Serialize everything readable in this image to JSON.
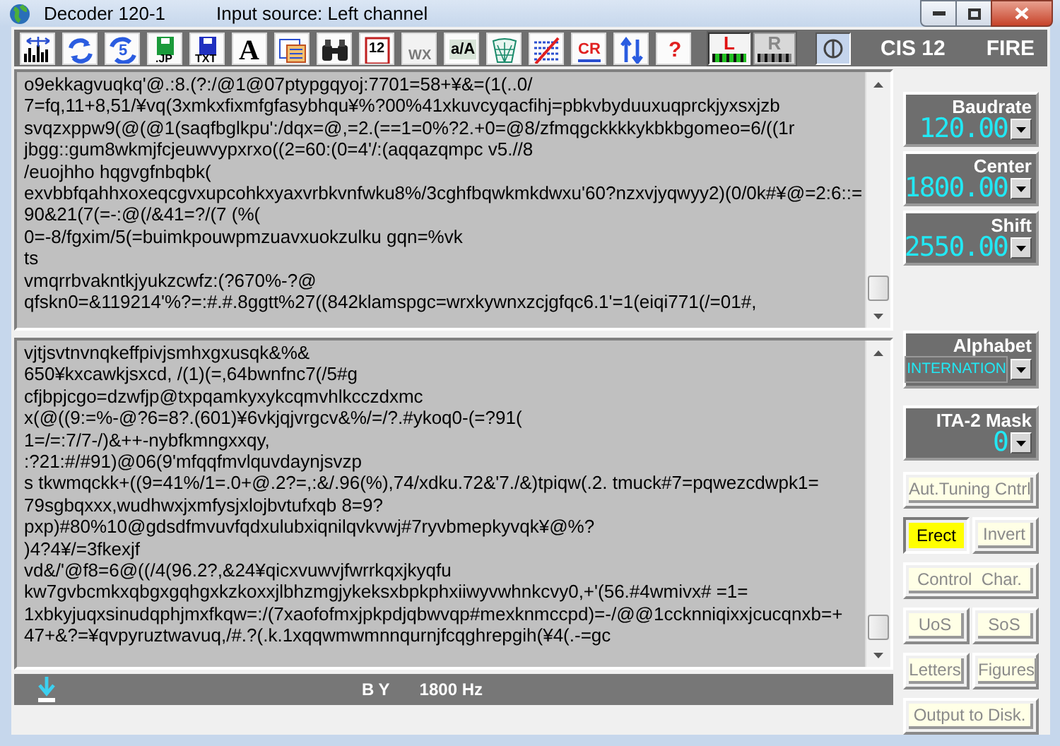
{
  "window": {
    "title": "Decoder 120-1",
    "input_source": "Input source: Left channel"
  },
  "toolbar": {
    "buttons": [
      {
        "disabled": false
      },
      {
        "disabled": false
      },
      {
        "glyph": "5",
        "disabled": false
      },
      {
        "glyph": ".JP",
        "disabled": false
      },
      {
        "glyph": "TXT",
        "disabled": false
      },
      {
        "glyph": "A",
        "disabled": false
      },
      {
        "disabled": false
      },
      {
        "disabled": false
      },
      {
        "glyph": "12",
        "disabled": false
      },
      {
        "glyph": "WX",
        "disabled": true
      },
      {
        "glyph": "a/A",
        "disabled": false
      },
      {
        "disabled": false
      },
      {
        "disabled": false
      },
      {
        "glyph": "CR",
        "disabled": false
      },
      {
        "disabled": false
      },
      {
        "glyph": "?",
        "disabled": false
      }
    ],
    "channels": [
      {
        "label": "L",
        "selected": true
      },
      {
        "label": "R",
        "selected": false
      }
    ],
    "monitor_pressed": true,
    "mode": "CIS 12",
    "mode_2": "FIRE"
  },
  "top_pane": {
    "lines": [
      "o9ekkagvuqkq'@.:8.(?:/@1@07ptypgqyoj:7701=58+¥&=(1(..0/",
      "7=fq,11+8,51/¥vq(3xmkxfixmfgfasybhqu¥%?00%41xkuvcyqacfihj=pbkvbyduuxuqprckjyxsxjzb",
      "svqzxppw9(@(@1(saqfbglkpu':/dqx=@,=2.(==1=0%?2.+0=@8/zfmqgckkkkykbkbgomeo=6/((1r",
      "jbgg::gum8wkmjfcjeuwvypxrxo((2=60:(0=4'/:(aqqazqmpc v5.//8",
      "/euojhho hqgvgfnbqbk(",
      "exvbbfqahhxoxeqcgvxupcohkxyaxvrbkvnfwku8%/3cghfbqwkmkdwxu'60?nzxvjyqwyy2)(0/0k#¥@=2:6::=",
      "90&21(7(=-:@(/&41=?/(7 (%(",
      "0=-8/fgxim/5(=buimkpouwpmzuavxuokzulku gqn=%vk",
      "ts",
      "vmqrrbvakntkjyukzcwfz:(?670%-?@",
      "qfskn0=&119214'%?=:#.#.8ggtt%27((842klamspgc=wrxkywnxzcjgfqc6.1'=1(eiqi771(/=01#,"
    ]
  },
  "bottom_pane": {
    "lines": [
      "vjtjsvtnvnqkeffpivjsmhxgxusqk&%&",
      "650¥kxcawkjsxcd, /(1)(=,64bwnfnc7(/5#g",
      "cfjbpjcgo=dzwfjp@txpqamkyxykcqmvhlkcczdxmc",
      "x(@((9:=%-@?6=8?.(601)¥6vkjqjvrgcv&%/=/?.#ykoq0-(=?91(",
      "1=/=:7/7-/)&++-nybfkmngxxqy,",
      ":?21:#/#91)@06(9'mfqqfmvlquvdaynjsvzp",
      "s tkwmqckk+((9=41%/1=.0+@.2?=,:&/.96(%),74/xdku.72&'7./&)tpiqw(.2. tmuck#7=pqwezcdwpk1=",
      "79sgbqxxx,wudhwxjxmfysjxlojbvtufxqb 8=9?",
      "pxp)#80%10@gdsdfmvuvfqdxulubxiqnilqvkvwj#7ryvbmepkyvqk¥@%?",
      ")4?4¥/=3fkexjf",
      "vd&/'@f8=6@((/4(96.2?,&24¥qicxvuwvjfwrrkqxjkyqfu",
      "kw7gvbcmkxqbgxgqhgxkzkoxxjlbhzmgjykeksxbpkphxiiwyvwhnkcvy0,+'(56.#4wmivx# =1=",
      "1xbkyjuqxsinudqphjmxfkqw=:/(7xaofofmxjpkpdjqbwvqp#mexknmccpd)=-/@@1ccknniqixxjcucqnxb=+",
      "47+&?=¥qvpyruztwavuq,/#.?(.k.1xqqwmwmnnqurnjfcqghrepgih(¥4(.-=gc"
    ]
  },
  "status_bar": {
    "shift_mode": "B Y",
    "frequency": "1800 Hz"
  },
  "parameters": [
    {
      "label": "Baudrate",
      "value": "120.00"
    },
    {
      "label": "Center",
      "value": "1800.00"
    },
    {
      "label": "Shift",
      "value": "2550.00"
    },
    {
      "label": "Alphabet",
      "value": "INTERNATION"
    },
    {
      "label": "ITA-2 Mask",
      "value": "0"
    }
  ],
  "buttons": [
    {
      "kind": "wide",
      "label": "Aut.Tuning Cntrl",
      "selected": false
    },
    {
      "kind": "half",
      "label": "Erect",
      "selected": true
    },
    {
      "kind": "half",
      "label": "Invert",
      "selected": false
    },
    {
      "kind": "wide",
      "label": "Control  Char.",
      "selected": false
    },
    {
      "kind": "half",
      "label": "UoS",
      "selected": false
    },
    {
      "kind": "half",
      "label": "SoS",
      "selected": false
    },
    {
      "kind": "half",
      "label": "Letters",
      "selected": false
    },
    {
      "kind": "half",
      "label": "Figures",
      "selected": false
    },
    {
      "kind": "wide",
      "label": "Output to Disk.",
      "selected": false
    }
  ]
}
